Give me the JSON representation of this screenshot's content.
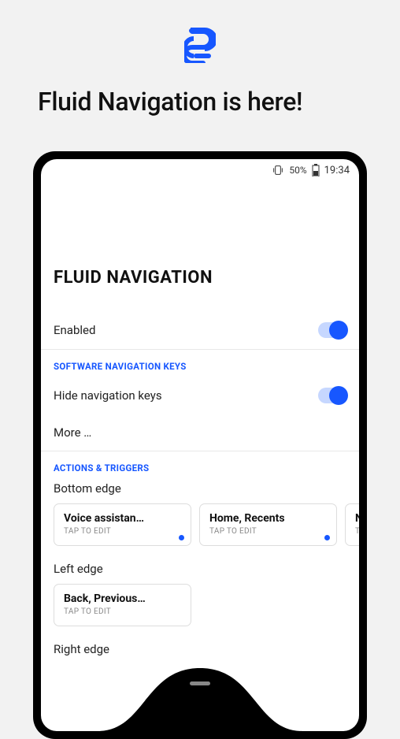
{
  "headline": "Fluid Navigation is here!",
  "status": {
    "battery_pct": "50%",
    "time": "19:34"
  },
  "screen_title": "FLUID NAVIGATION",
  "enabled": {
    "label": "Enabled"
  },
  "section_nav_keys": {
    "header": "SOFTWARE NAVIGATION KEYS",
    "hide_label": "Hide navigation keys",
    "more_label": "More …"
  },
  "section_actions": {
    "header": "ACTIONS & TRIGGERS",
    "bottom_label": "Bottom edge",
    "left_label": "Left edge",
    "right_label": "Right edge",
    "tap_hint": "TAP TO EDIT",
    "cards_bottom": [
      {
        "title": "Voice assistan…"
      },
      {
        "title": "Home, Recents"
      },
      {
        "title": "No"
      }
    ],
    "cards_left": [
      {
        "title": "Back, Previous…"
      }
    ]
  }
}
